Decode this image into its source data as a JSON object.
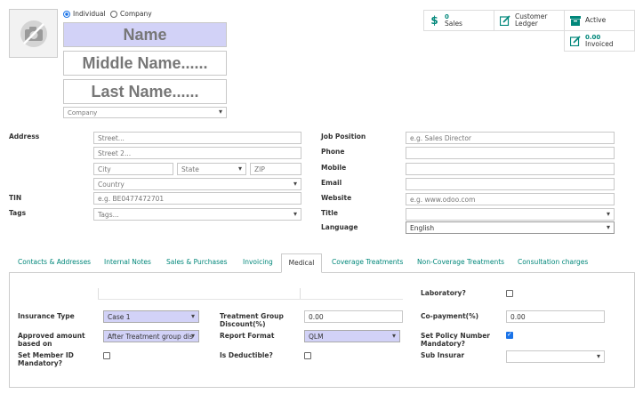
{
  "partner_type": {
    "individual": "Individual",
    "company": "Company",
    "selected": "individual"
  },
  "names": {
    "name": "Name",
    "middle": "Middle Name......",
    "last": "Last Name......"
  },
  "company_select": "Company",
  "stat_buttons": {
    "sales_count": "0",
    "sales_label": "Sales",
    "ledger_label_1": "Customer",
    "ledger_label_2": "Ledger",
    "active_label": "Active",
    "invoiced_amount": "0.00",
    "invoiced_label": "Invoiced"
  },
  "address": {
    "label": "Address",
    "street_ph": "Street...",
    "street2_ph": "Street 2...",
    "city_ph": "City",
    "state_ph": "State",
    "zip_ph": "ZIP",
    "country_ph": "Country"
  },
  "tin": {
    "label": "TIN",
    "placeholder": "e.g. BE0477472701"
  },
  "tags": {
    "label": "Tags",
    "placeholder": "Tags..."
  },
  "right_fields": {
    "job_position": {
      "label": "Job Position",
      "placeholder": "e.g. Sales Director"
    },
    "phone": {
      "label": "Phone"
    },
    "mobile": {
      "label": "Mobile"
    },
    "email": {
      "label": "Email"
    },
    "website": {
      "label": "Website",
      "placeholder": "e.g. www.odoo.com"
    },
    "title": {
      "label": "Title"
    },
    "language": {
      "label": "Language",
      "value": "English"
    }
  },
  "tabs": [
    {
      "label": "Contacts & Addresses"
    },
    {
      "label": "Internal Notes"
    },
    {
      "label": "Sales & Purchases"
    },
    {
      "label": "Invoicing"
    },
    {
      "label": "Medical"
    },
    {
      "label": "Coverage Treatments"
    },
    {
      "label": "Non-Coverage Treatments"
    },
    {
      "label": "Consultation charges"
    }
  ],
  "active_tab": "Medical",
  "medical": {
    "laboratory": {
      "label": "Laboratory?",
      "checked": false
    },
    "insurance_type": {
      "label": "Insurance Type",
      "value": "Case 1"
    },
    "treatment_group_discount": {
      "label_1": "Treatment Group",
      "label_2": "Discount(%)",
      "value": "0.00"
    },
    "copayment": {
      "label": "Co-payment(%)",
      "value": "0.00"
    },
    "approved_amount": {
      "label_1": "Approved amount",
      "label_2": "based on",
      "value": "After Treatment group dis"
    },
    "report_format": {
      "label": "Report Format",
      "value": "QLM"
    },
    "set_policy_number": {
      "label_1": "Set Policy Number",
      "label_2": "Mandatory?",
      "checked": true
    },
    "set_member_id": {
      "label_1": "Set Member ID",
      "label_2": "Mandatory?",
      "checked": false
    },
    "is_deductible": {
      "label": "Is Deductible?",
      "checked": false
    },
    "sub_insurar": {
      "label": "Sub Insurar",
      "value": ""
    }
  },
  "colors": {
    "accent": "#00877a",
    "required_bg": "#d2d2f7",
    "checkbox_on": "#1a73e8"
  }
}
